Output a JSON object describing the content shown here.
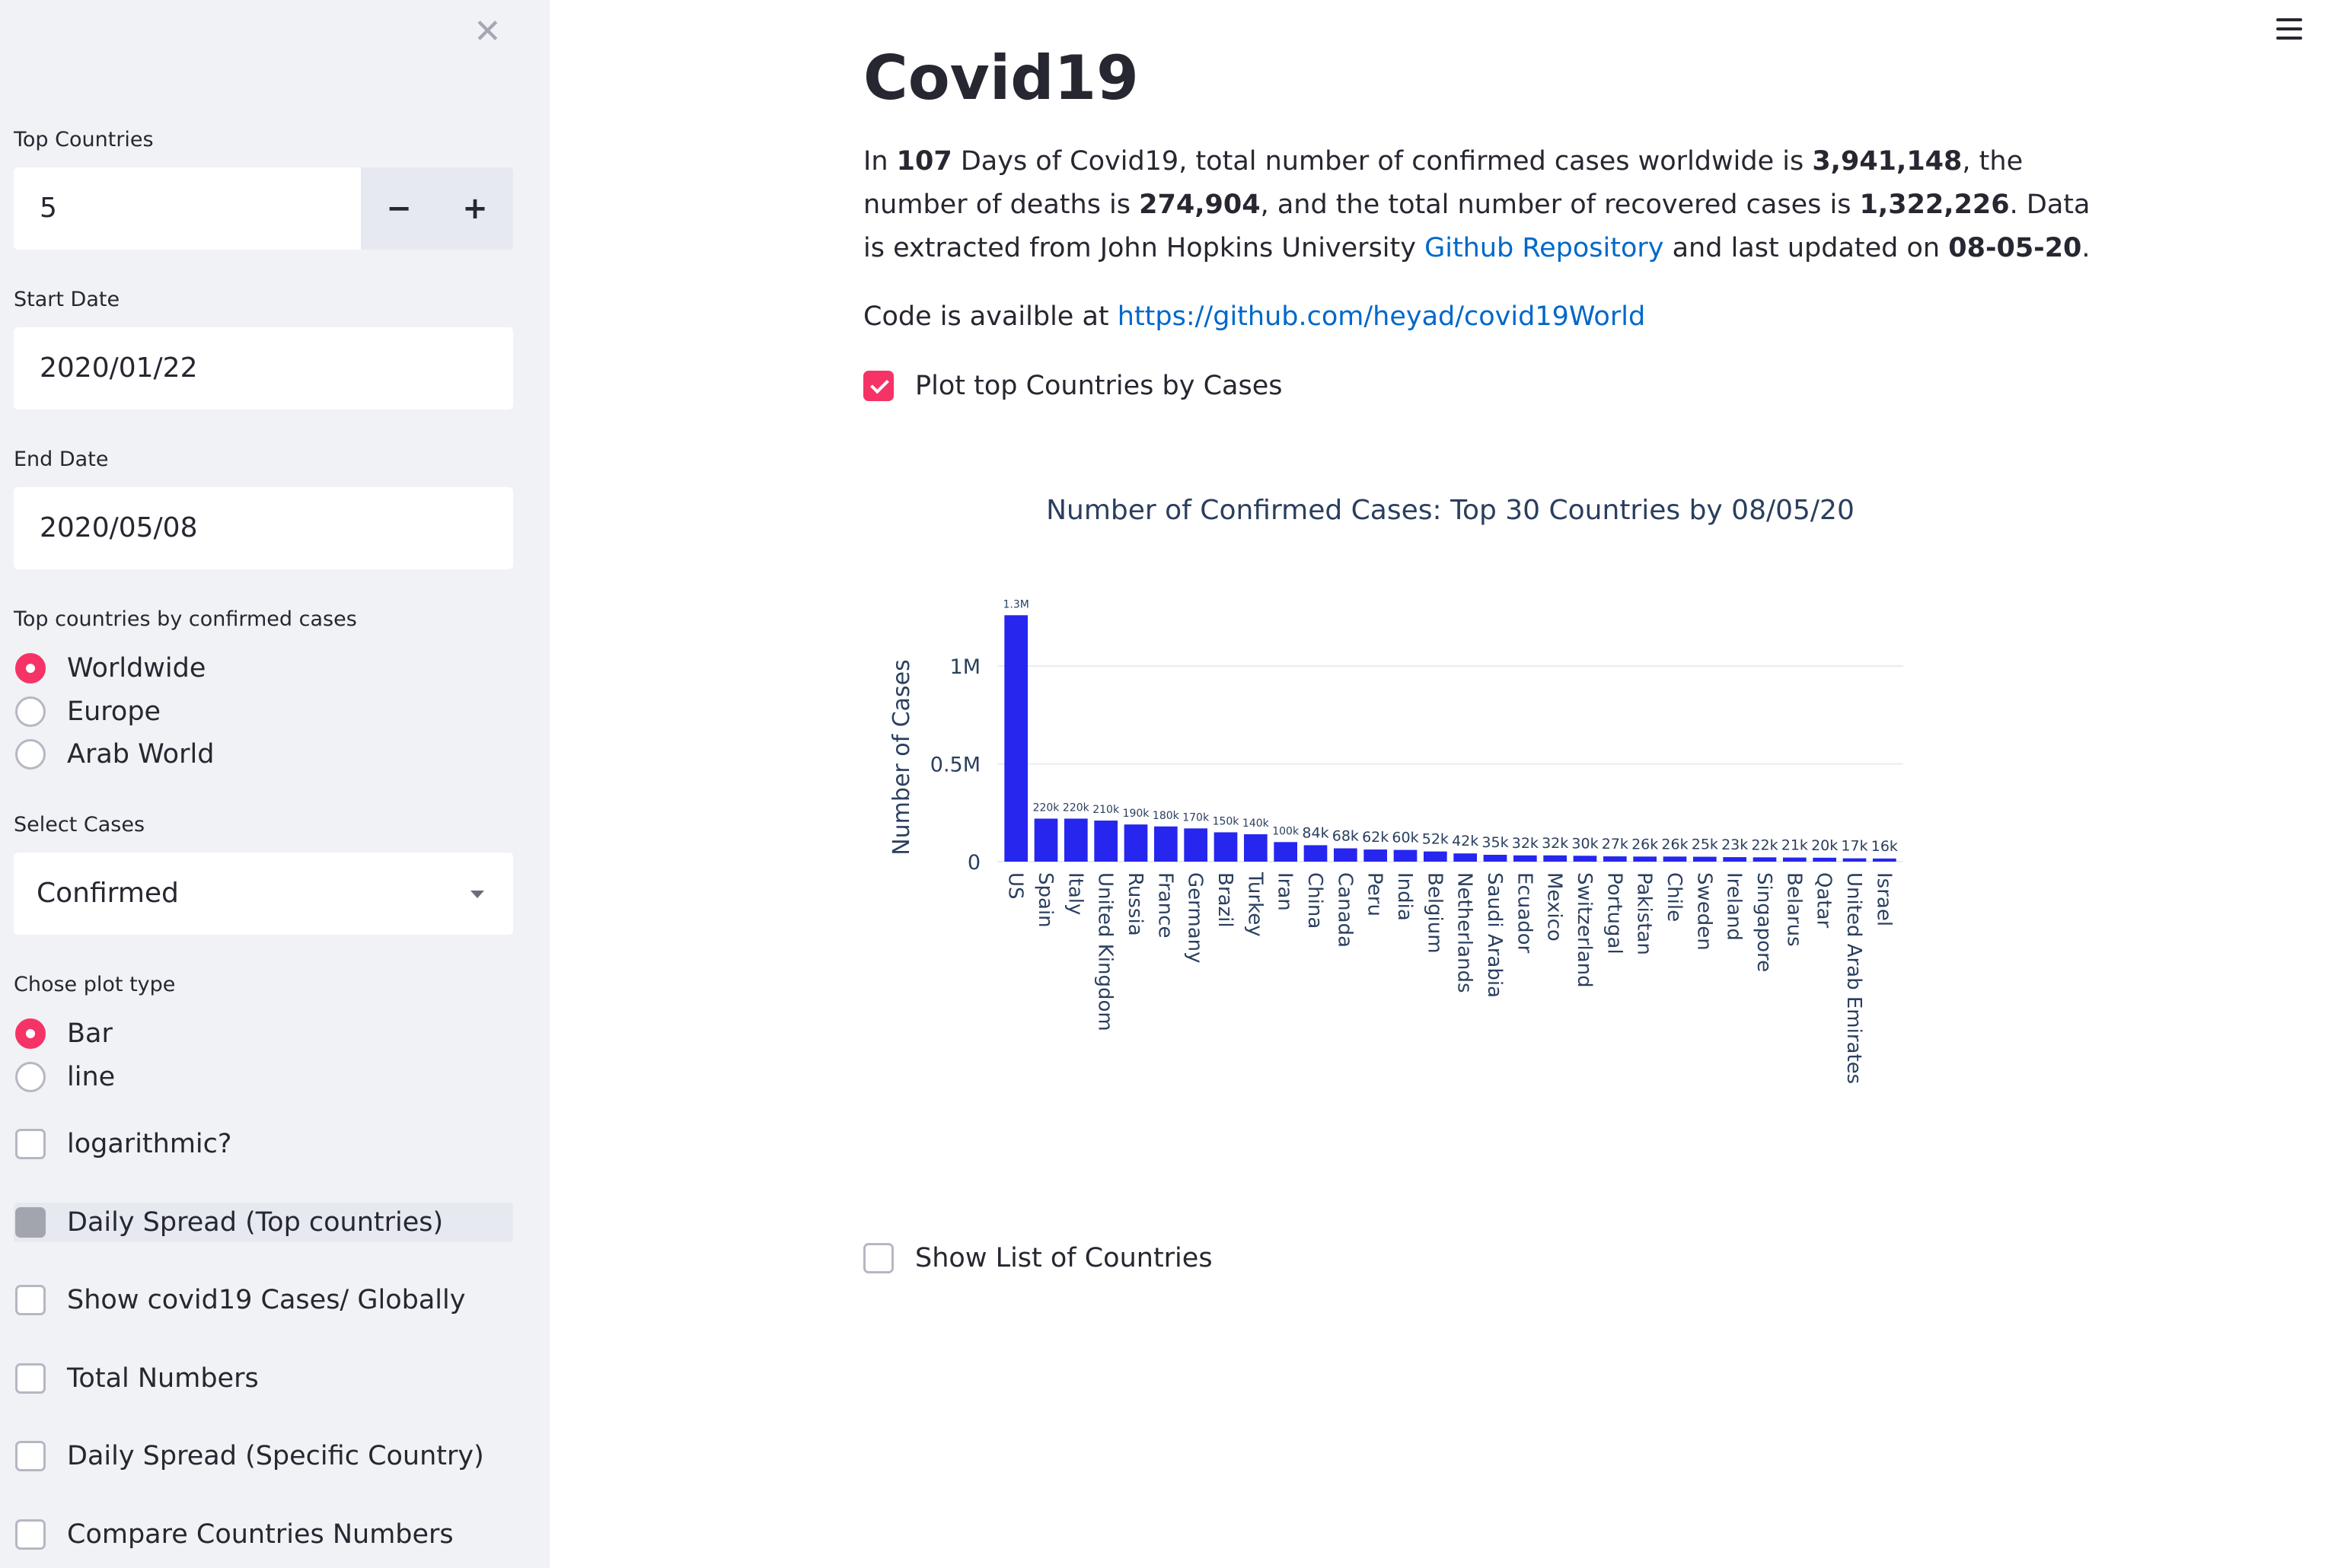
{
  "sidebar": {
    "close_icon": "close-icon",
    "top_countries": {
      "label": "Top Countries",
      "value": "5",
      "minus": "−",
      "plus": "+"
    },
    "start_date": {
      "label": "Start Date",
      "value": "2020/01/22"
    },
    "end_date": {
      "label": "End Date",
      "value": "2020/05/08"
    },
    "region": {
      "label": "Top countries by confirmed cases",
      "options": [
        "Worldwide",
        "Europe",
        "Arab World"
      ],
      "selected": "Worldwide"
    },
    "cases": {
      "label": "Select Cases",
      "value": "Confirmed"
    },
    "plot_type": {
      "label": "Chose plot type",
      "options": [
        "Bar",
        "line"
      ],
      "selected": "Bar"
    },
    "checkboxes": {
      "logarithmic": "logarithmic?",
      "daily_spread_top": "Daily Spread (Top countries)",
      "show_global": "Show covid19 Cases/ Globally",
      "total_numbers": "Total Numbers",
      "daily_specific": "Daily Spread (Specific Country)",
      "compare": "Compare Countries Numbers"
    }
  },
  "main": {
    "menu_icon": "hamburger-menu-icon",
    "title": "Covid19",
    "summary": {
      "t1": "In ",
      "days": "107",
      "t2": " Days of Covid19, total number of confirmed cases worldwide is ",
      "confirmed": "3,941,148",
      "t3": ", the number of deaths is ",
      "deaths": "274,904",
      "t4": ", and the total number of recovered cases is ",
      "recovered": "1,322,226",
      "t5": ". Data is extracted from John Hopkins University ",
      "link": "Github Repository",
      "t6": " and last updated on ",
      "updated": "08-05-20",
      "t7": "."
    },
    "code": {
      "text": "Code is availble at ",
      "link": "https://github.com/heyad/covid19World"
    },
    "plot_checkbox": "Plot top Countries by Cases",
    "list_checkbox": "Show List of Countries"
  },
  "chart_data": {
    "type": "bar",
    "title": "Number of Confirmed Cases: Top 30 Countries  by 08/05/20",
    "ylabel": "Number of Cases",
    "xlabel": "",
    "ylim": [
      0,
      1300000
    ],
    "yticks": [
      {
        "v": 0,
        "t": "0"
      },
      {
        "v": 500000,
        "t": "0.5M"
      },
      {
        "v": 1000000,
        "t": "1M"
      }
    ],
    "color": "#2626ee",
    "categories": [
      "US",
      "Spain",
      "Italy",
      "United Kingdom",
      "Russia",
      "France",
      "Germany",
      "Brazil",
      "Turkey",
      "Iran",
      "China",
      "Canada",
      "Peru",
      "India",
      "Belgium",
      "Netherlands",
      "Saudi Arabia",
      "Ecuador",
      "Mexico",
      "Switzerland",
      "Portugal",
      "Pakistan",
      "Chile",
      "Sweden",
      "Ireland",
      "Singapore",
      "Belarus",
      "Qatar",
      "United Arab Emirates",
      "Israel"
    ],
    "values": [
      1260000,
      220000,
      220000,
      210000,
      190000,
      180000,
      170000,
      150000,
      140000,
      100000,
      84000,
      68000,
      62000,
      60000,
      52000,
      42000,
      35000,
      32000,
      32000,
      30000,
      27000,
      26000,
      26000,
      25000,
      23000,
      22000,
      21000,
      20000,
      17000,
      16000
    ],
    "labels": [
      "1.3M",
      "220k",
      "220k",
      "210k",
      "190k",
      "180k",
      "170k",
      "150k",
      "140k",
      "100k",
      "84k",
      "68k",
      "62k",
      "60k",
      "52k",
      "42k",
      "35k",
      "32k",
      "32k",
      "30k",
      "27k",
      "26k",
      "26k",
      "25k",
      "23k",
      "22k",
      "21k",
      "20k",
      "17k",
      "16k"
    ]
  }
}
